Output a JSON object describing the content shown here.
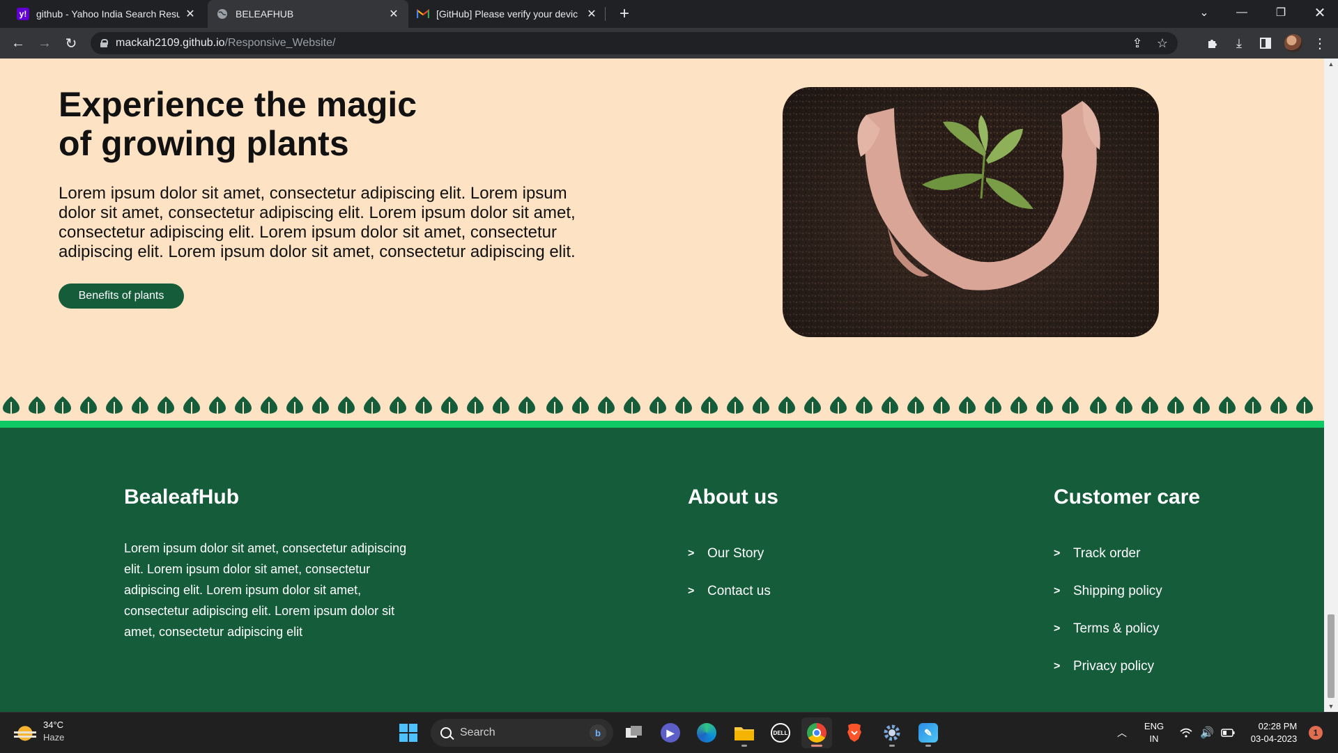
{
  "browser": {
    "tabs": [
      {
        "title": "github - Yahoo India Search Resu",
        "favicon": "yahoo-icon",
        "color": "#6001d2"
      },
      {
        "title": "BELEAFHUB",
        "favicon": "globe-icon",
        "color": "#9aa0a6"
      },
      {
        "title": "[GitHub] Please verify your devic",
        "favicon": "gmail-icon",
        "color": "#ea4335"
      }
    ],
    "url_host": "mackah2109.github.io",
    "url_path": "/Responsive_Website/"
  },
  "hero": {
    "title_line1": "Experience the magic",
    "title_line2": "of growing plants",
    "text": "Lorem ipsum dolor sit amet, consectetur adipiscing elit. Lorem ipsum dolor sit amet, consectetur adipiscing elit. Lorem ipsum dolor sit amet, consectetur adipiscing elit. Lorem ipsum dolor sit amet, consectetur adipiscing elit. Lorem ipsum dolor sit amet, consectetur adipiscing elit.",
    "button_label": "Benefits of plants"
  },
  "footer": {
    "brand": {
      "title": "BealeafHub",
      "description": "Lorem ipsum dolor sit amet, consectetur adipiscing elit. Lorem ipsum dolor sit amet, consectetur adipiscing elit. Lorem ipsum dolor sit amet, consectetur adipiscing elit. Lorem ipsum dolor sit amet, consectetur adipiscing elit"
    },
    "about": {
      "title": "About us",
      "links": [
        "Our Story",
        "Contact us"
      ]
    },
    "care": {
      "title": "Customer care",
      "links": [
        "Track order",
        "Shipping policy",
        "Terms & policy",
        "Privacy policy"
      ]
    },
    "chevron": ">"
  },
  "taskbar": {
    "weather_temp": "34°C",
    "weather_cond": "Haze",
    "search_placeholder": "Search",
    "lang_line1": "ENG",
    "lang_line2": "IN",
    "time": "02:28 PM",
    "date": "03-04-2023",
    "notification_count": "1"
  },
  "colors": {
    "page_bg": "#fde2c4",
    "accent_green": "#145c3a",
    "bright_green": "#0fc964"
  }
}
